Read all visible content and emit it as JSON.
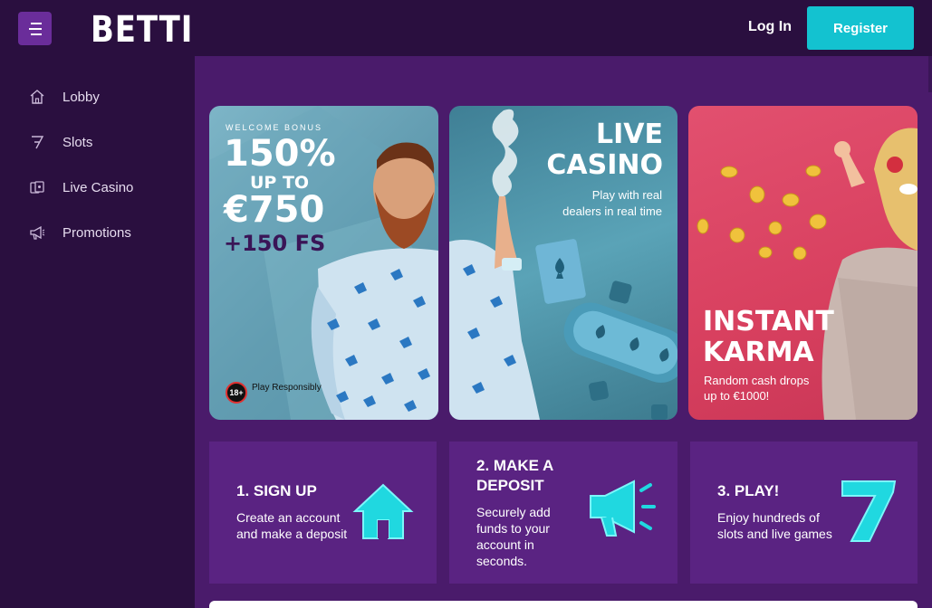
{
  "header": {
    "logo": "BETTI",
    "login_label": "Log In",
    "register_label": "Register"
  },
  "sidebar": {
    "items": [
      {
        "label": "Lobby",
        "icon": "home-icon"
      },
      {
        "label": "Slots",
        "icon": "seven-icon"
      },
      {
        "label": "Live Casino",
        "icon": "cards-icon"
      },
      {
        "label": "Promotions",
        "icon": "megaphone-icon"
      }
    ]
  },
  "banners": {
    "welcome": {
      "kicker": "WELCOME BONUS",
      "percent": "150%",
      "upto": "UP TO",
      "amount": "€750",
      "spins": "+150 FS",
      "age_badge": "18+",
      "responsible": "Play Responsibly"
    },
    "live": {
      "title_line1": "LIVE",
      "title_line2": "CASINO",
      "sub_line1": "Play with real",
      "sub_line2": "dealers in real time"
    },
    "karma": {
      "title_line1": "INSTANT",
      "title_line2": "KARMA",
      "sub_line1": "Random cash drops",
      "sub_line2": "up to €1000!"
    }
  },
  "steps": [
    {
      "title": "1. SIGN UP",
      "desc_line1": "Create an account",
      "desc_line2": "and make a deposit",
      "icon": "house-neon-icon"
    },
    {
      "title_line1": "2. MAKE A",
      "title_line2": "DEPOSIT",
      "desc_line1": "Securely add",
      "desc_line2": "funds to your",
      "desc_line3": "account in",
      "desc_line4": "seconds.",
      "icon": "megaphone-neon-icon"
    },
    {
      "title": "3. PLAY!",
      "desc_line1": "Enjoy hundreds of",
      "desc_line2": "slots and live games",
      "icon": "seven-neon-icon"
    }
  ],
  "colors": {
    "page_bg": "#4a1b6b",
    "header_bg": "#2a0f3f",
    "accent": "#13c2d0",
    "step_bg": "#5a2382",
    "karma_bg": "#d8405f"
  }
}
